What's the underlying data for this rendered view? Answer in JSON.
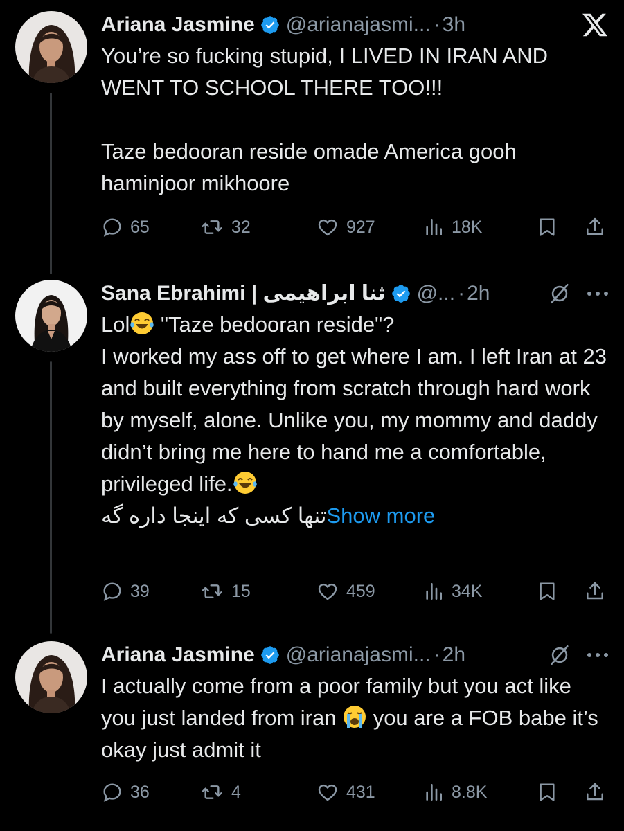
{
  "tweets": [
    {
      "name": "Ariana Jasmine",
      "handle": "@arianajasmi...",
      "separator": "·",
      "time": "3h",
      "header_icon": "x-logo-icon",
      "text_before": "You’re so fucking stupid, I LIVED IN IRAN AND WENT TO SCHOOL THERE TOO!!!\n\nTaze bedooran reside omade America gooh haminjoor mikhoore",
      "replies": "65",
      "retweets": "32",
      "likes": "927",
      "views": "18K"
    },
    {
      "name": "Sana Ebrahimi | ",
      "name_ar": "ثنا ابراهیمی",
      "handle": "@...",
      "separator": "·",
      "time": "2h",
      "header_icon": "grok-icon",
      "text_1": "Lol",
      "text_2": " \"Taze bedooran reside\"?\nI worked my ass off to get where I am. I left Iran at 23 and built everything from scratch through hard work by myself, alone. Unlike you, my mommy and daddy didn’t bring me here to hand me a comfortable, privileged life.",
      "text_farsi": "تنها کسی که اینجا داره گه",
      "show_more": "Show more",
      "replies": "39",
      "retweets": "15",
      "likes": "459",
      "views": "34K"
    },
    {
      "name": "Ariana Jasmine",
      "handle": "@arianajasmi...",
      "separator": "·",
      "time": "2h",
      "header_icon": "grok-icon",
      "text_1": "I actually come from a poor family but you act like you just landed from iran ",
      "text_2": " you are a FOB babe it’s okay just admit it",
      "replies": "36",
      "retweets": "4",
      "likes": "431",
      "views": "8.8K"
    }
  ],
  "colors": {
    "background": "#000000",
    "text": "#e7e9ea",
    "muted": "#8b98a5",
    "link": "#1d9bf0",
    "verified": "#1d9bf0",
    "thread_line": "#333639"
  }
}
